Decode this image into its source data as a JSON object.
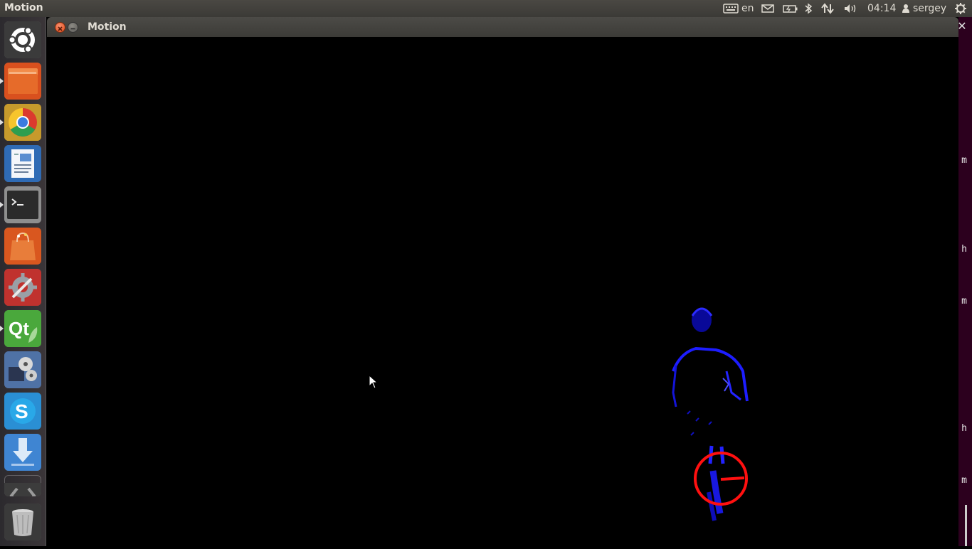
{
  "topbar": {
    "app_name": "Motion",
    "keyboard_layout": "en",
    "clock": "04:14",
    "user": "sergey"
  },
  "launcher": {
    "items": [
      {
        "name": "dash-home",
        "icon": "ubuntu-logo-icon"
      },
      {
        "name": "files",
        "icon": "folder-icon"
      },
      {
        "name": "chrome",
        "icon": "chrome-icon"
      },
      {
        "name": "writer",
        "icon": "document-icon"
      },
      {
        "name": "terminal",
        "icon": "terminal-icon"
      },
      {
        "name": "software-center",
        "icon": "shopping-bag-icon"
      },
      {
        "name": "system-settings",
        "icon": "settings-icon"
      },
      {
        "name": "qt-creator",
        "icon": "qt-icon"
      },
      {
        "name": "media-player",
        "icon": "film-reel-icon"
      },
      {
        "name": "skype",
        "icon": "skype-icon"
      },
      {
        "name": "downloader",
        "icon": "download-arrow-icon"
      },
      {
        "name": "code-editor",
        "icon": "code-brackets-icon"
      },
      {
        "name": "trash",
        "icon": "trash-icon"
      }
    ]
  },
  "window": {
    "title": "Motion"
  },
  "right_strip": {
    "letters": [
      "m",
      "h",
      "m",
      "h",
      "m"
    ]
  },
  "colors": {
    "figure": "#1a1aff",
    "marker": "#ff1010",
    "close": "#e0541e",
    "background": "#000000"
  }
}
